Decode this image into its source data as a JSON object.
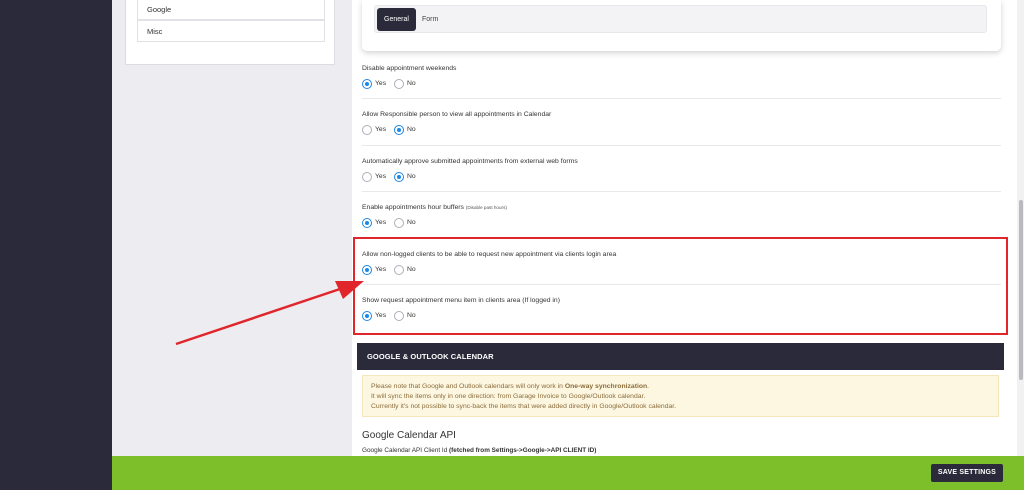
{
  "sidebar": {
    "items": [
      {
        "label": "Google"
      },
      {
        "label": "Misc"
      }
    ]
  },
  "tabs": [
    {
      "label": "General",
      "active": true
    },
    {
      "label": "Form",
      "active": false
    }
  ],
  "settings": [
    {
      "label": "Disable appointment weekends",
      "note": "",
      "selected": "Yes"
    },
    {
      "label": "Allow Responsible person to view all appointments in Calendar",
      "note": "",
      "selected": "No"
    },
    {
      "label": "Automatically approve submitted appointments from external web forms",
      "note": "",
      "selected": "No"
    },
    {
      "label": "Enable appointments hour buffers",
      "note": "(Disable past hours)",
      "selected": "Yes"
    },
    {
      "label": "Allow non-logged clients to be able to request new appointment via clients login area",
      "note": "",
      "selected": "Yes"
    },
    {
      "label": "Show request appointment menu item in clients area (If logged in)",
      "note": "",
      "selected": "Yes"
    }
  ],
  "radio_options": {
    "yes": "Yes",
    "no": "No"
  },
  "google_outlook": {
    "header": "GOOGLE & OUTLOOK CALENDAR",
    "notice_line1_prefix": "Please note that Google and Outlook calendars will only work in ",
    "notice_line1_bold": "One-way synchronization",
    "notice_line1_suffix": ".",
    "notice_line2": "It will sync the items only in one direction: from Garage Invoice to Google/Outlook calendar.",
    "notice_line3": "Currently it's not possible to sync-back the items that were added directly in Google/Outlook calendar.",
    "api_title": "Google Calendar API",
    "client_id_label": "Google Calendar API Client Id ",
    "client_id_hint": "(fetched from Settings->Google->API CLIENT ID)"
  },
  "footer": {
    "save_label": "SAVE SETTINGS"
  },
  "colors": {
    "dark": "#2b2a3a",
    "accent_blue": "#1e88e5",
    "footer_green": "#7cbf2a",
    "highlight_red": "#e0252b",
    "notice_bg": "#fdf6e0"
  }
}
